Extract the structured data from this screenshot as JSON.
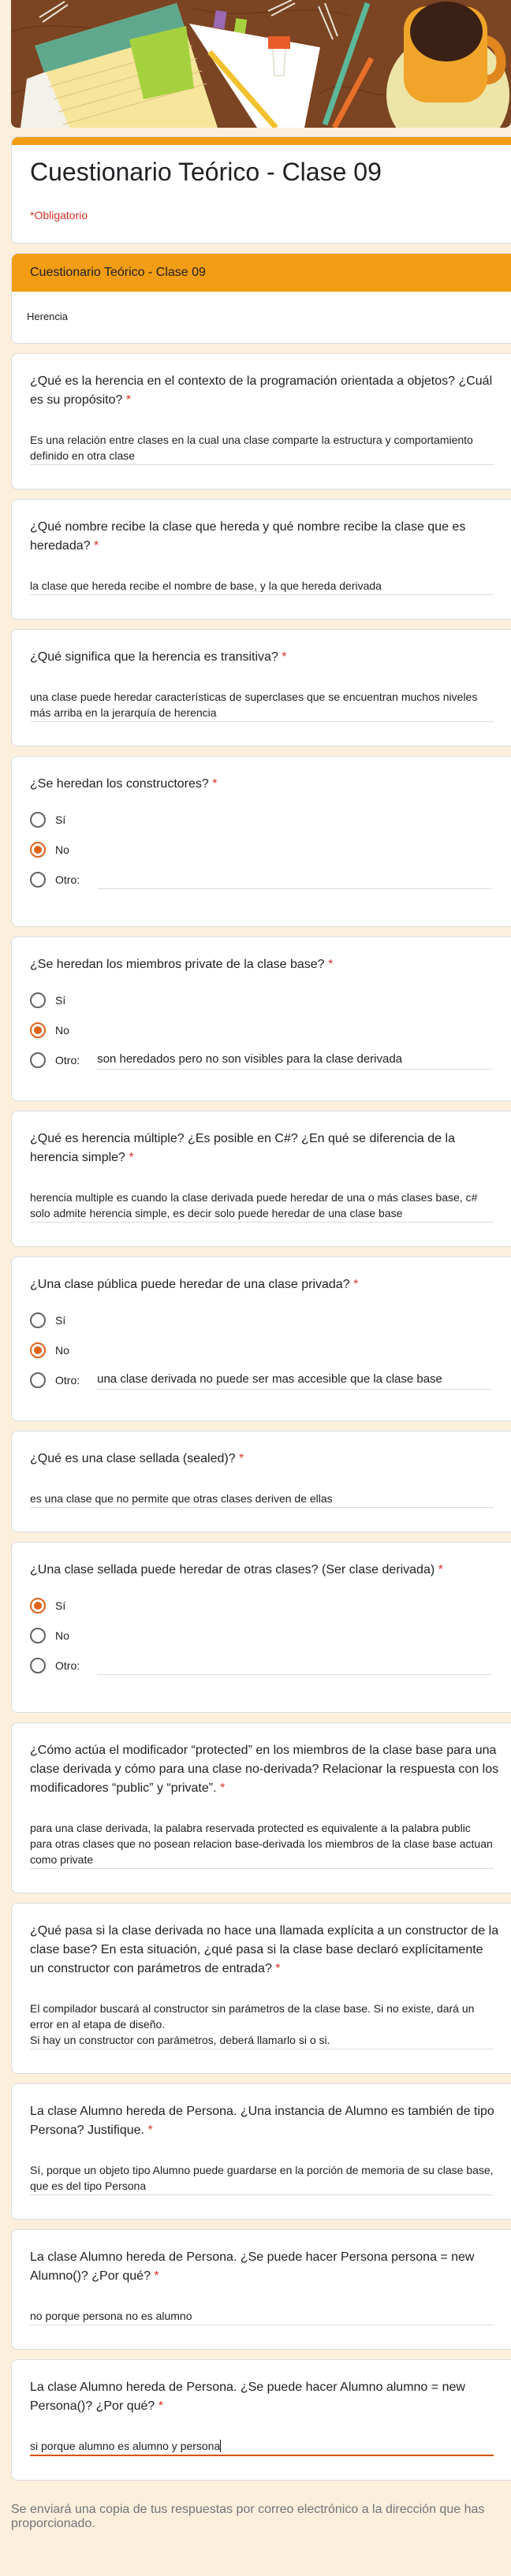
{
  "form": {
    "title": "Cuestionario Teórico - Clase 09",
    "required_note": "*Obligatorio",
    "accent_color": "#f29d13",
    "selection_color": "#e0631a"
  },
  "section": {
    "title": "Cuestionario Teórico - Clase 09",
    "description": "Herencia"
  },
  "required_mark": "*",
  "questions": [
    {
      "type": "text",
      "label": "¿Qué es la herencia en el contexto de la programación orientada a objetos? ¿Cuál es su propósito?",
      "answer": "Es una relación entre clases en la cual una clase comparte la estructura y comportamiento definido en otra clase"
    },
    {
      "type": "text",
      "label": "¿Qué nombre recibe la clase que hereda y qué nombre recibe la clase que es heredada?",
      "answer": "la clase que hereda recibe el nombre de base, y la que hereda derivada"
    },
    {
      "type": "text",
      "label": "¿Qué significa que la herencia es transitiva?",
      "answer": "una clase puede heredar características de superclases que se encuentran muchos niveles más arriba en la jerarquía de herencia"
    },
    {
      "type": "radio",
      "label": "¿Se heredan los constructores?",
      "options": [
        "Sí",
        "No",
        "Otro:"
      ],
      "selected": "No",
      "other_value": ""
    },
    {
      "type": "radio",
      "label": "¿Se heredan los miembros private de la clase base?",
      "options": [
        "Sí",
        "No",
        "Otro:"
      ],
      "selected": "No",
      "other_value": "son heredados pero no son visibles para la clase derivada"
    },
    {
      "type": "text",
      "label": "¿Qué es herencia múltiple? ¿Es posible en C#? ¿En qué se diferencia de la herencia simple?",
      "answer": "herencia multiple es cuando la clase derivada puede heredar de una o más clases base, c# solo admite herencia simple, es decir solo puede heredar de una clase base"
    },
    {
      "type": "radio",
      "label": "¿Una clase pública puede heredar de una clase privada?",
      "options": [
        "Sí",
        "No",
        "Otro:"
      ],
      "selected": "No",
      "other_value": "una clase derivada no puede ser mas accesible que la clase base"
    },
    {
      "type": "text",
      "label": "¿Qué es una clase sellada (sealed)?",
      "answer": "es una clase que no permite que otras clases deriven de ellas"
    },
    {
      "type": "radio",
      "label": "¿Una clase sellada puede heredar de otras clases? (Ser clase derivada)",
      "options": [
        "Sí",
        "No",
        "Otro:"
      ],
      "selected": "Sí",
      "other_value": ""
    },
    {
      "type": "text",
      "label": "¿Cómo actúa el modificador “protected” en los miembros de la clase base para una clase derivada y cómo para una clase no-derivada? Relacionar la respuesta con los modificadores “public” y “private”.",
      "answer": "para una clase derivada, la palabra reservada protected es equivalente a la palabra public para otras clases que no posean relacion base-derivada los miembros de la clase base actuan como private"
    },
    {
      "type": "text",
      "label": "¿Qué pasa si la clase derivada no hace una llamada explícita a un constructor de la clase base? En esta situación, ¿qué pasa si la clase base declaró explícitamente un constructor con parámetros de entrada?",
      "answer": "El compilador buscará al constructor sin parámetros de la clase base. Si no existe, dará un error en al etapa de diseño.\nSi hay un constructor con parámetros, deberá llamarlo si o si."
    },
    {
      "type": "text",
      "label": "La clase Alumno hereda de Persona. ¿Una instancia de Alumno es también de tipo Persona? Justifique.",
      "answer": "Sí, porque un objeto tipo Alumno puede guardarse en la porción de memoria de su clase base, que es del tipo Persona"
    },
    {
      "type": "text",
      "label": "La clase Alumno hereda de Persona. ¿Se puede hacer Persona persona = new Alumno()? ¿Por qué?",
      "answer": "no porque persona no es alumno"
    },
    {
      "type": "text",
      "label": "La clase Alumno hereda de Persona. ¿Se puede hacer Alumno alumno = new Persona()? ¿Por qué?",
      "answer": "si porque alumno es alumno y persona",
      "focused": true
    }
  ],
  "footer": {
    "email_copy_note": "Se enviará una copia de tus respuestas por correo electrónico a la dirección que has proporcionado."
  }
}
